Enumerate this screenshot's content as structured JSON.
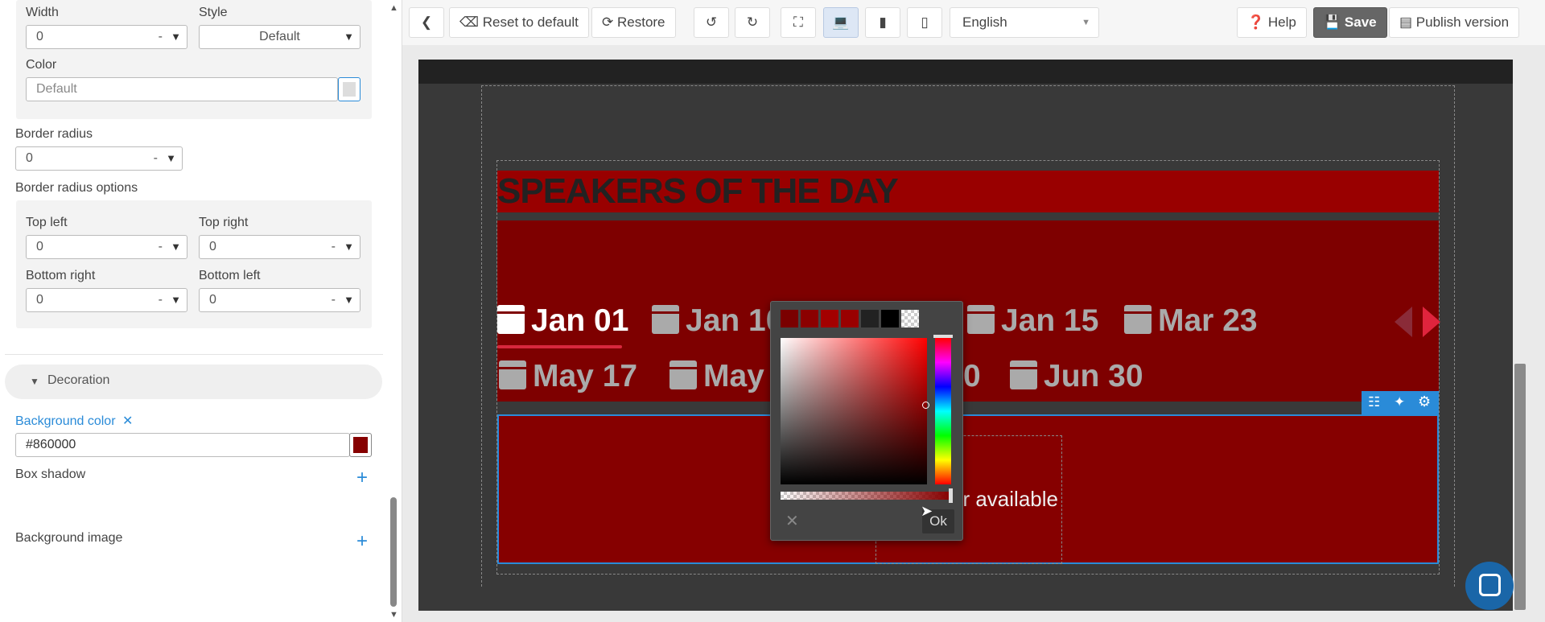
{
  "left_panel": {
    "width_label": "Width",
    "width_value": "0",
    "width_unit": "-",
    "style_label": "Style",
    "style_value": "Default",
    "color_label": "Color",
    "color_placeholder": "Default",
    "border_radius_label": "Border radius",
    "border_radius_value": "0",
    "border_radius_unit": "-",
    "border_radius_options_label": "Border radius options",
    "top_left_label": "Top left",
    "top_left_value": "0",
    "top_right_label": "Top right",
    "top_right_value": "0",
    "bottom_right_label": "Bottom right",
    "bottom_right_value": "0",
    "bottom_left_label": "Bottom left",
    "bottom_left_value": "0",
    "unit_dash": "-",
    "decoration_label": "Decoration",
    "background_color_label": "Background color",
    "background_color_value": "#860000",
    "box_shadow_label": "Box shadow",
    "background_image_label": "Background image"
  },
  "toolbar": {
    "reset_label": "Reset to default",
    "restore_label": "Restore",
    "language_value": "English",
    "help_label": "Help",
    "save_label": "Save",
    "publish_label": "Publish version"
  },
  "preview": {
    "heading": "SPEAKERS OF THE DAY",
    "dates_row1": [
      "Jan 01",
      "Jan 10",
      "Jan 15",
      "Mar 23"
    ],
    "dates_row2": [
      "May 17",
      "May",
      "0",
      "Jun 30"
    ],
    "partial_text": "er available"
  },
  "color_picker": {
    "ok_label": "Ok",
    "swatches": [
      "#7a0000",
      "#8b0000",
      "#a30000",
      "#990000",
      "#222222",
      "#000000",
      "checker"
    ]
  },
  "colors": {
    "accent": "#2a8bd8",
    "selected_background": "#860000",
    "heading_band": "#990000",
    "section_background": "#7e0000"
  }
}
